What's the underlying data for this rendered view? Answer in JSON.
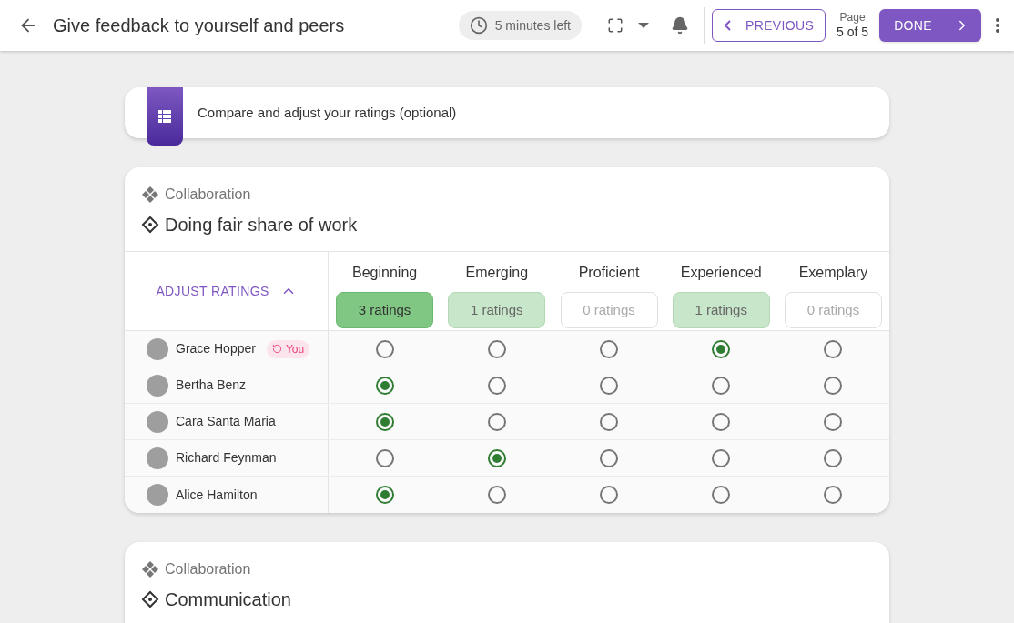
{
  "header": {
    "title": "Give feedback to yourself and peers",
    "timer": "5 minutes left",
    "previous": "PREVIOUS",
    "page_label": "Page",
    "page_count": "5 of 5",
    "done": "DONE"
  },
  "banner": {
    "text": "Compare and adjust your ratings (optional)"
  },
  "cards": [
    {
      "category": "Collaboration",
      "title": "Doing fair share of work",
      "adjust": "ADJUST RATINGS",
      "expanded": true,
      "levels": [
        {
          "label": "Beginning",
          "count": "3 ratings",
          "kind": "strong"
        },
        {
          "label": "Emerging",
          "count": "1 ratings",
          "kind": "light"
        },
        {
          "label": "Proficient",
          "count": "0 ratings",
          "kind": "empty"
        },
        {
          "label": "Experienced",
          "count": "1 ratings",
          "kind": "light"
        },
        {
          "label": "Exemplary",
          "count": "0 ratings",
          "kind": "empty"
        }
      ],
      "rows": [
        {
          "name": "Grace Hopper",
          "badge": "You",
          "choices": [
            {
              "selected": false
            },
            {
              "selected": false
            },
            {
              "selected": false
            },
            {
              "selected": true
            },
            {
              "selected": false
            }
          ]
        },
        {
          "name": "Bertha Benz",
          "choices": [
            {
              "selected": true
            },
            {
              "selected": false
            },
            {
              "selected": false
            },
            {
              "selected": false
            },
            {
              "selected": false
            }
          ]
        },
        {
          "name": "Cara Santa Maria",
          "choices": [
            {
              "selected": true
            },
            {
              "selected": false
            },
            {
              "selected": false
            },
            {
              "selected": false
            },
            {
              "selected": false
            }
          ]
        },
        {
          "name": "Richard Feynman",
          "choices": [
            {
              "selected": false
            },
            {
              "selected": true
            },
            {
              "selected": false
            },
            {
              "selected": false
            },
            {
              "selected": false
            }
          ]
        },
        {
          "name": "Alice Hamilton",
          "choices": [
            {
              "selected": true
            },
            {
              "selected": false
            },
            {
              "selected": false
            },
            {
              "selected": false
            },
            {
              "selected": false
            }
          ]
        }
      ]
    },
    {
      "category": "Collaboration",
      "title": "Communication"
    }
  ]
}
